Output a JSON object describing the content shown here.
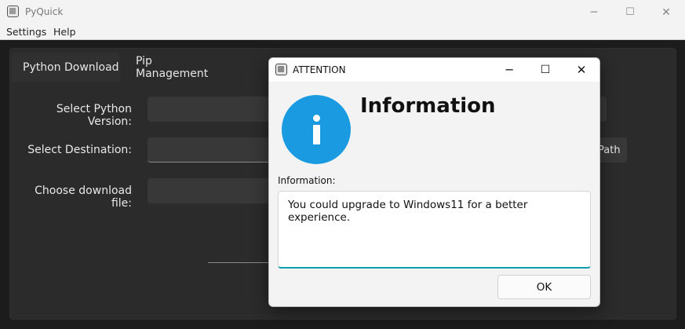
{
  "window": {
    "title": "PyQuick",
    "controls": {
      "minimize": "─",
      "maximize": "☐",
      "close": "✕"
    }
  },
  "menu": {
    "items": [
      "Settings",
      "Help"
    ]
  },
  "tabs": [
    {
      "label": "Python Download",
      "active": true
    },
    {
      "label": "Pip Management",
      "active": false
    }
  ],
  "form": {
    "version_label": "Select Python Version:",
    "destination_label": "Select Destination:",
    "download_label": "Choose download file:",
    "path_button_partial": "Path"
  },
  "dialog": {
    "title": "ATTENTION",
    "controls": {
      "minimize": "─",
      "maximize": "☐",
      "close": "✕"
    },
    "icon": "info-icon",
    "heading": "Information",
    "sublabel": "Information:",
    "message": "You could upgrade to Windows11 for a better experience.",
    "ok_label": "OK",
    "accent": "#1a9ae0"
  }
}
